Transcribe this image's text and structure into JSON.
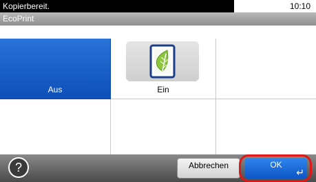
{
  "status": {
    "message": "Kopierbereit.",
    "time": "10:10"
  },
  "screen": {
    "title": "EcoPrint"
  },
  "options": [
    {
      "label": "Aus",
      "selected": true
    },
    {
      "label": "Ein",
      "selected": false,
      "icon": "leaf-icon"
    }
  ],
  "footer": {
    "help_icon": "help-icon",
    "cancel_label": "Abbrechen",
    "ok_label": "OK"
  },
  "colors": {
    "selected": "#1a63cc",
    "ok": "#1f6fe0",
    "highlight_ring": "#e01818"
  }
}
